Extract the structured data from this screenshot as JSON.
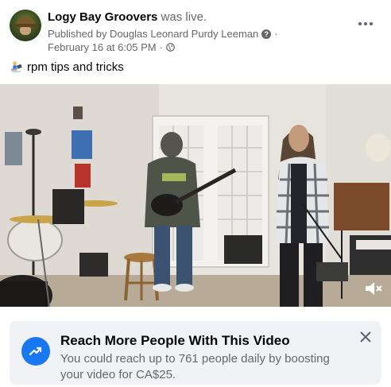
{
  "post": {
    "page_name": "Logy Bay Groovers",
    "status": " was live.",
    "published_by": "Published by Douglas Leonard Purdy Leeman",
    "help_icon": "?",
    "separator": "·",
    "date": "February 16 at 6:05 PM",
    "audience_icon": "globe-icon",
    "caption": "rpm tips and tricks",
    "caption_icon": "person-with-laptop-emoji"
  },
  "video": {
    "icon": "volume-muted-icon"
  },
  "boost": {
    "title": "Reach More People With This Video",
    "text": "You could reach up to 761 people daily by boosting your video for CA$25.",
    "icon": "trending-up-icon",
    "close_icon": "close-icon"
  },
  "colors": {
    "accent": "#1877f2",
    "secondary_text": "#65676b",
    "panel_bg": "#f0f2f5"
  }
}
